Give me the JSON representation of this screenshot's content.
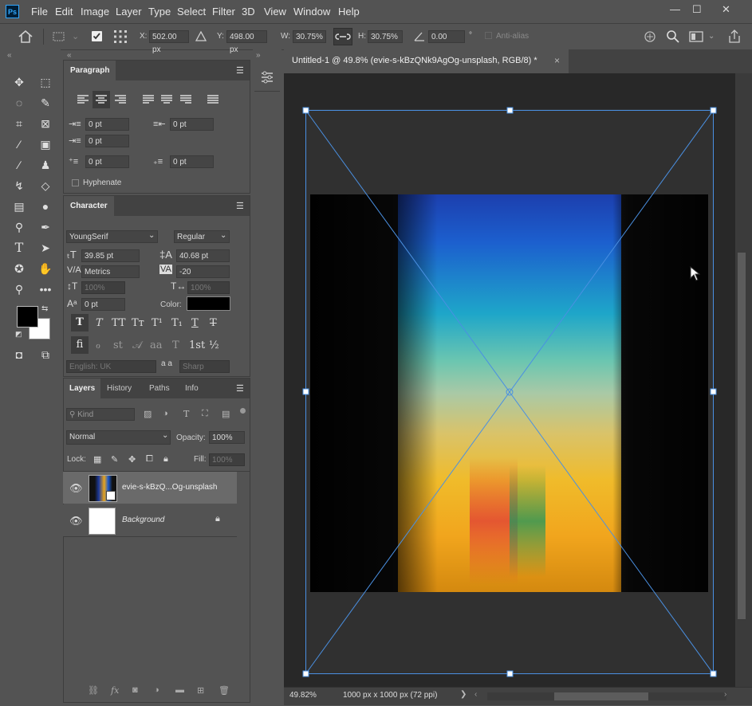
{
  "app": {
    "logo": "Ps"
  },
  "menu": [
    "File",
    "Edit",
    "Image",
    "Layer",
    "Type",
    "Select",
    "Filter",
    "3D",
    "View",
    "Window",
    "Help"
  ],
  "window_buttons": {
    "minimize": "—",
    "restore": "☐",
    "close": "✕"
  },
  "options": {
    "x_label": "X:",
    "x_value": "502.00 px",
    "y_label": "Y:",
    "y_value": "498.00 px",
    "w_label": "W:",
    "w_value": "30.75%",
    "h_label": "H:",
    "h_value": "30.75%",
    "angle_value": "0.00",
    "degree": "°",
    "antialias_label": "Anti-alias"
  },
  "paragraph": {
    "tab": "Paragraph",
    "indent_left": "0 pt",
    "indent_right": "0 pt",
    "indent_first": "0 pt",
    "space_before": "0 pt",
    "space_after": "0 pt",
    "hyphenate": "Hyphenate"
  },
  "character": {
    "tab": "Character",
    "font_family": "YoungSerif",
    "font_style": "Regular",
    "font_size": "39.85 pt",
    "leading": "40.68 pt",
    "kerning": "Metrics",
    "tracking": "-20",
    "vscale": "100%",
    "hscale": "100%",
    "baseline": "0 pt",
    "color_label": "Color:",
    "color": "#000000",
    "style_buttons": [
      "T",
      "T",
      "TT",
      "Tт",
      "T¹",
      "T₁",
      "T",
      "T"
    ],
    "ot_buttons": [
      "fi",
      "ℴ",
      "st",
      "𝒜",
      "aa",
      "T",
      "1st",
      "½"
    ],
    "language": "English: UK",
    "aa_label": "a a",
    "aa_value": "Sharp"
  },
  "layers": {
    "tabs": [
      "Layers",
      "History",
      "Paths",
      "Info"
    ],
    "kind": "Kind",
    "blend": "Normal",
    "opacity_label": "Opacity:",
    "opacity": "100%",
    "lock_label": "Lock:",
    "fill_label": "Fill:",
    "fill": "100%",
    "items": [
      {
        "name": "evie-s-kBzQ...Og-unsplash",
        "selected": true
      },
      {
        "name": "Background",
        "selected": false,
        "locked": true
      }
    ]
  },
  "document": {
    "tab_title": "Untitled-1 @ 49.8% (evie-s-kBzQNk9AgOg-unsplash, RGB/8) *",
    "close": "×"
  },
  "status": {
    "zoom": "49.82%",
    "info": "1000 px x 1000 px (72 ppi)",
    "arrow": "❯"
  },
  "colors": {
    "accent": "#4a90e2",
    "foreground": "#000000",
    "background": "#ffffff"
  }
}
